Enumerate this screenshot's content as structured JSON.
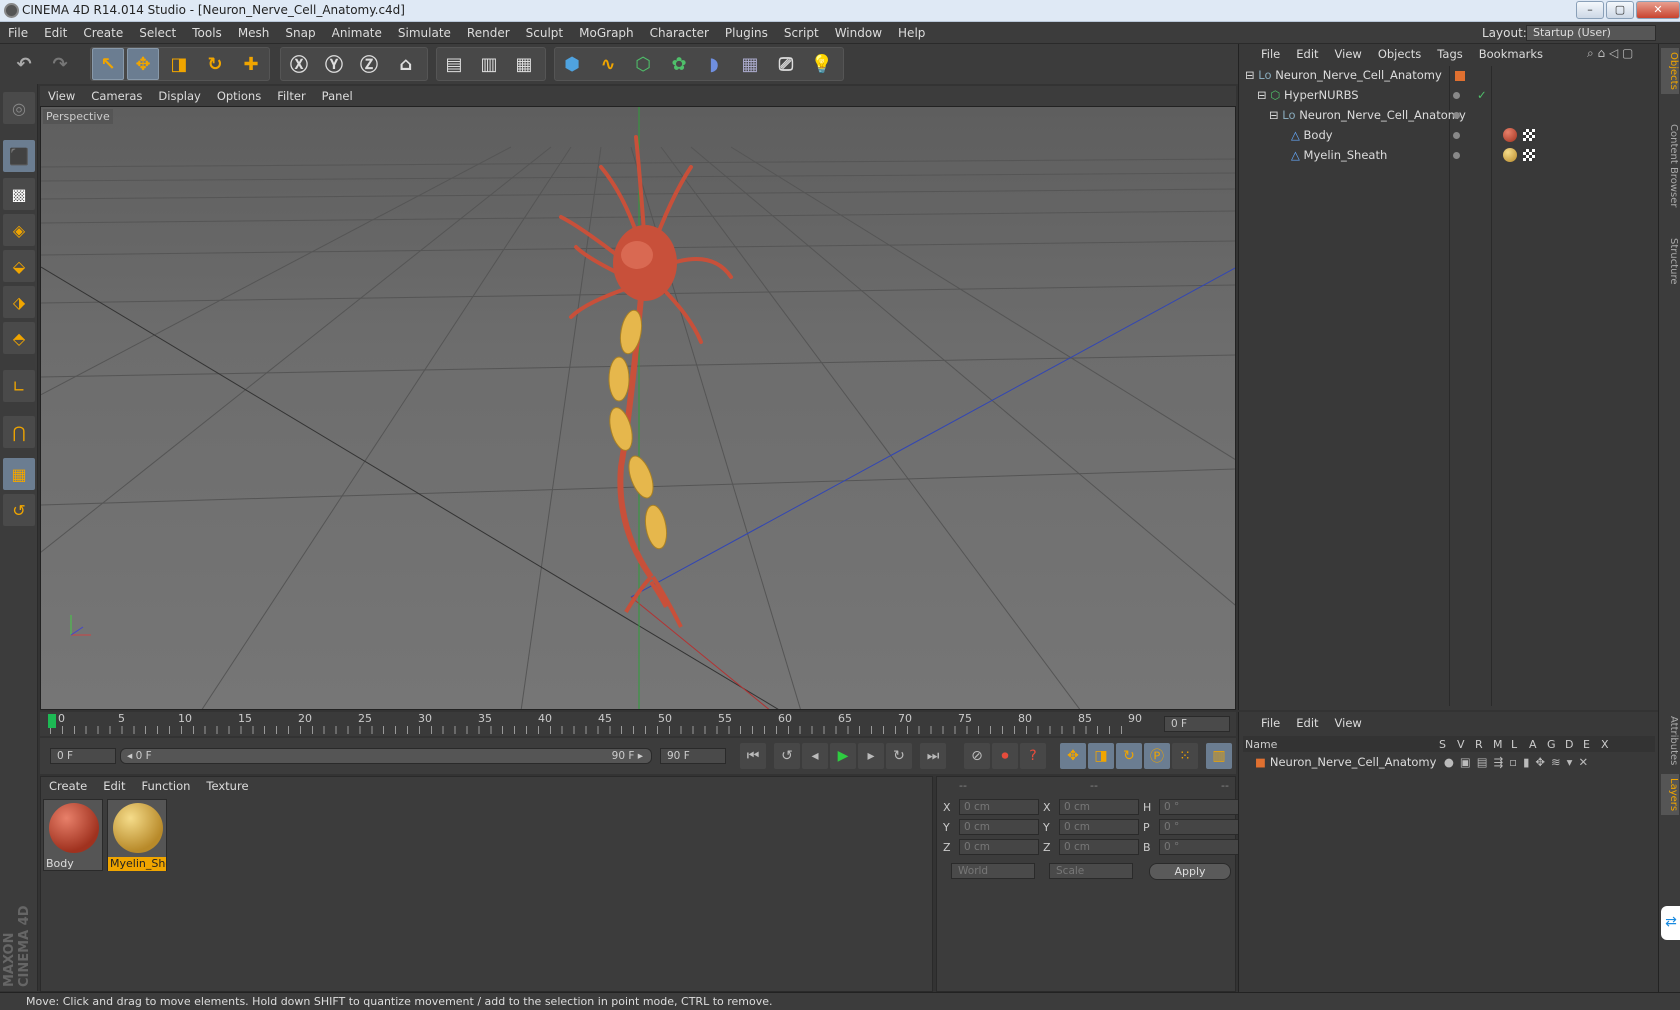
{
  "window": {
    "title": "CINEMA 4D R14.014 Studio - [Neuron_Nerve_Cell_Anatomy.c4d]",
    "min": "–",
    "max": "▢",
    "close": "✕"
  },
  "menu": [
    "File",
    "Edit",
    "Create",
    "Select",
    "Tools",
    "Mesh",
    "Snap",
    "Animate",
    "Simulate",
    "Render",
    "Sculpt",
    "MoGraph",
    "Character",
    "Plugins",
    "Script",
    "Window",
    "Help"
  ],
  "layout": {
    "label": "Layout:",
    "value": "Startup (User)"
  },
  "viewport": {
    "menu": [
      "View",
      "Cameras",
      "Display",
      "Options",
      "Filter",
      "Panel"
    ],
    "label": "Perspective"
  },
  "timeline": {
    "ticks": [
      "0",
      "5",
      "10",
      "15",
      "20",
      "25",
      "30",
      "35",
      "40",
      "45",
      "50",
      "55",
      "60",
      "65",
      "70",
      "75",
      "80",
      "85",
      "90"
    ],
    "current_frame": "0 F"
  },
  "playback": {
    "start_field": "0 F",
    "range_start": "◂ 0 F",
    "range_end": "90 F ▸",
    "end_field": "90 F"
  },
  "materials": {
    "menu": [
      "Create",
      "Edit",
      "Function",
      "Texture"
    ],
    "items": [
      {
        "name": "Body",
        "color": "#c0392b"
      },
      {
        "name": "Myelin_She",
        "color": "#e0b84a"
      }
    ]
  },
  "coords": {
    "headers": [
      "--",
      "--",
      "--"
    ],
    "rows": [
      [
        "X",
        "0 cm",
        "X",
        "0 cm",
        "H",
        "0 °"
      ],
      [
        "Y",
        "0 cm",
        "Y",
        "0 cm",
        "P",
        "0 °"
      ],
      [
        "Z",
        "0 cm",
        "Z",
        "0 cm",
        "B",
        "0 °"
      ]
    ],
    "mode1": "World",
    "mode2": "Scale",
    "apply": "Apply"
  },
  "objects": {
    "menu": [
      "File",
      "Edit",
      "View",
      "Objects",
      "Tags",
      "Bookmarks"
    ],
    "rows": [
      {
        "name": "Neuron_Nerve_Cell_Anatomy",
        "indent": 0
      },
      {
        "name": "HyperNURBS",
        "indent": 1
      },
      {
        "name": "Neuron_Nerve_Cell_Anatomy",
        "indent": 2
      },
      {
        "name": "Body",
        "indent": 3
      },
      {
        "name": "Myelin_Sheath",
        "indent": 3
      }
    ]
  },
  "layers": {
    "menu": [
      "File",
      "Edit",
      "View"
    ],
    "columns": [
      "Name",
      "S",
      "V",
      "R",
      "M",
      "L",
      "A",
      "G",
      "D",
      "E",
      "X"
    ],
    "row": "Neuron_Nerve_Cell_Anatomy"
  },
  "sidetabs": [
    "Objects",
    "Content Browser",
    "Structure",
    "Attributes",
    "Layers"
  ],
  "status": "Move: Click and drag to move elements. Hold down SHIFT to quantize movement / add to the selection in point mode, CTRL to remove.",
  "brand": "MAXON CINEMA 4D"
}
